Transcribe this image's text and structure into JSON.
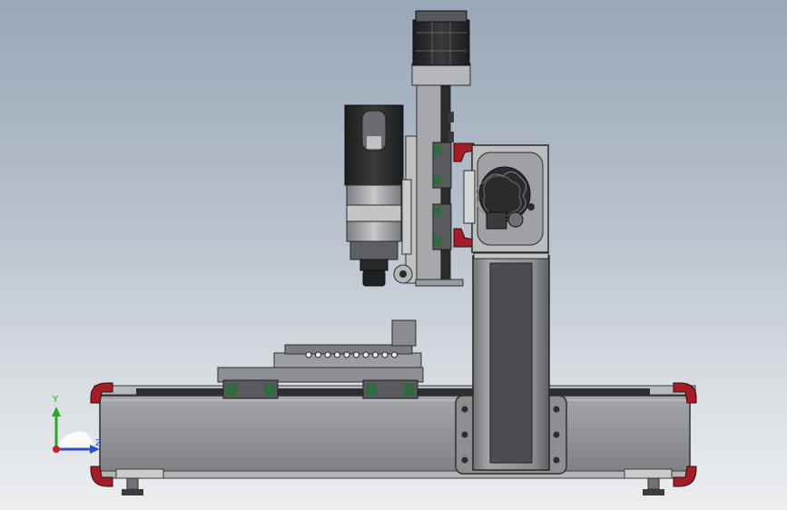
{
  "viewport": {
    "background_top": "#9aa7b8",
    "background_bottom": "#eceef0"
  },
  "model": {
    "frame_color": "#8c8e91",
    "steel_color": "#a9abae",
    "dark_color": "#2a2b2d",
    "rail_block_color": "#2f6b3f",
    "end_cap_color": "#9c1c24"
  },
  "triad": {
    "y_label": "Y",
    "z_label": "Z",
    "y_color": "#2aa72a",
    "z_color": "#2b52c9",
    "x_color": "#c8202a"
  }
}
